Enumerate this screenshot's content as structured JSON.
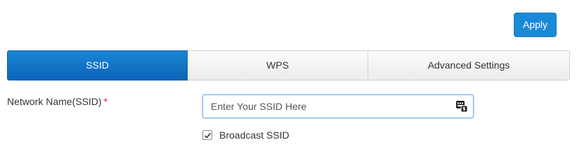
{
  "toolbar": {
    "apply_label": "Apply"
  },
  "tabs": [
    {
      "label": "SSID",
      "active": true
    },
    {
      "label": "WPS",
      "active": false
    },
    {
      "label": "Advanced Settings",
      "active": false
    }
  ],
  "form": {
    "ssid_label": "Network Name(SSID)",
    "required_marker": "*",
    "ssid_value": "",
    "ssid_placeholder": "Enter Your SSID Here",
    "password_manager_icon": "keys-icon",
    "broadcast_ssid_label": "Broadcast SSID",
    "broadcast_ssid_checked": true
  },
  "colors": {
    "accent": "#1a8ad8",
    "active_tab": "#0c63b8",
    "required": "#e0262d"
  }
}
